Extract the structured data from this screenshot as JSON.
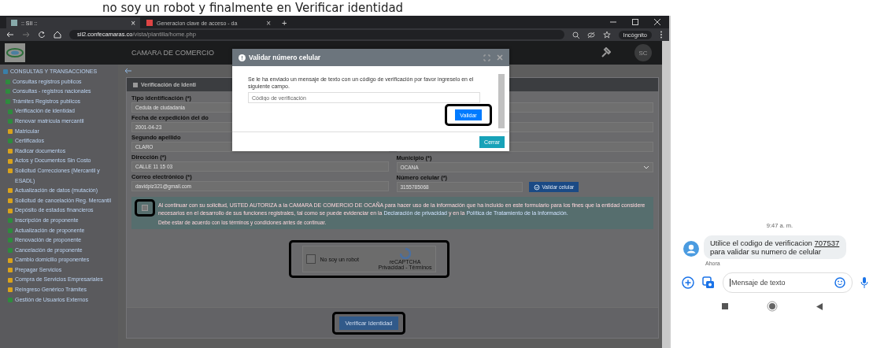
{
  "caption": "no soy un robot y finalmente en Verificar identidad",
  "browser": {
    "tabs": [
      {
        "title": ":: SII ::",
        "close": "×",
        "selected": true
      },
      {
        "title": "Generacion clave de acceso - da",
        "close": "×",
        "selected": false
      }
    ],
    "new_tab": "+",
    "url_host": "sii2.confecamaras.co",
    "url_path": "/vista/plantilla/home.php",
    "profile": "Incógnito"
  },
  "header": {
    "title": "CAMARA DE COMERCIO",
    "avatar": "SC"
  },
  "sidebar": {
    "items": [
      {
        "label": "CONSULTAS Y TRANSACCIONES",
        "color": "#3a7fa8",
        "children": [
          {
            "label": "Consultas registros publicos",
            "color": "#2e8b3e"
          },
          {
            "label": "Consultas - registros nacionales",
            "color": "#2e8b3e"
          },
          {
            "label": "Trámites Registros publicos",
            "color": "#2e8b3e",
            "children": [
              {
                "label": "Verificación de identidad",
                "color": "#2e8b3e"
              },
              {
                "label": "Renovar matrícula mercantil",
                "color": "#2e8b3e"
              },
              {
                "label": "Matricular",
                "color": "#d9a21b"
              },
              {
                "label": "Certificados",
                "color": "#2e8b3e"
              },
              {
                "label": "Radicar documentos",
                "color": "#d9a21b"
              },
              {
                "label": "Actos y Documentos Sin Costo",
                "color": "#d9a21b"
              },
              {
                "label": "Solicitud Correcciones (Mercantil y ESADL)",
                "color": "#d9a21b"
              },
              {
                "label": "Actualización de datos (mutación)",
                "color": "#d9a21b"
              },
              {
                "label": "Solicitud de cancelación Reg. Mercantil",
                "color": "#d9a21b"
              },
              {
                "label": "Depósito de estados financieros",
                "color": "#d9a21b"
              },
              {
                "label": "Inscripción de proponente",
                "color": "#2e8b3e"
              },
              {
                "label": "Actualización de proponente",
                "color": "#2e8b3e"
              },
              {
                "label": "Renovación de proponente",
                "color": "#2e8b3e"
              },
              {
                "label": "Cancelación de proponente",
                "color": "#2e8b3e"
              },
              {
                "label": "Cambio domicilio proponentes",
                "color": "#d9a21b"
              },
              {
                "label": "Prepagar Servicios",
                "color": "#d9a21b"
              },
              {
                "label": "Compra de Servicios Empresariales",
                "color": "#d9a21b"
              },
              {
                "label": "Reingreso Genérico Trámites",
                "color": "#d9a21b"
              },
              {
                "label": "Gestión de Usuarios Externos",
                "color": "#2e8b3e"
              }
            ]
          }
        ]
      }
    ]
  },
  "panel": {
    "title": "Verificación de Identi",
    "left_fields": [
      {
        "label": "Tipo identificación (*)",
        "value": "Cedula de ciudadania"
      },
      {
        "label": "Fecha de expedición del do",
        "value": "2001-04-23"
      },
      {
        "label": "Segundo apellido",
        "value": "CLARO"
      },
      {
        "label": "Dirección (*)",
        "value": "CALLE 11 15 03"
      },
      {
        "label": "Correo electrónico (*)",
        "value": "davidpiz321@gmail.com"
      }
    ],
    "right_fields": [
      {
        "label": "Municipio (*)",
        "value": "OCANA",
        "kind": "select"
      },
      {
        "label": "Número celular (*)",
        "value": "3155785068",
        "kind": "phone",
        "button": "Validar celular"
      }
    ],
    "consent": {
      "checked": false,
      "text_before": "Al continuar con su solicitud, USTED AUTORIZA a la CAMARA DE COMERCIO DE OCAÑA para hacer uso de la información que ha incluido en este formulario para los fines que la entidad considere necesarios en el desarrollo de sus funciones registrales, tal como se puede evidenciar en la",
      "link1": "Declaración de privacidad",
      "middle": "y en la",
      "link2": "Política de Tratamiento de la Información.",
      "warning": "Debe estar de acuerdo con los términos y condiciones antes de continuar."
    },
    "captcha": {
      "label": "No soy un robot",
      "checked": false,
      "brand": "reCAPTCHA",
      "terms": "Privacidad - Términos"
    },
    "submit": "Verificar Identidad"
  },
  "modal": {
    "title": "Validar número celular",
    "message": "Se le ha enviado un mensaje de texto con un código de verificación por favor ingreselo en el siguiente campo.",
    "placeholder": "Código de verificación",
    "validate": "Validar",
    "close": "Cerrar"
  },
  "phone": {
    "time": "9:47 a. m.",
    "message_before": "Utilice el codigo de verificacion",
    "code": "707537",
    "message_after": "para validar su numero de celular",
    "when": "Ahora",
    "placeholder": "Mensaje de texto"
  }
}
